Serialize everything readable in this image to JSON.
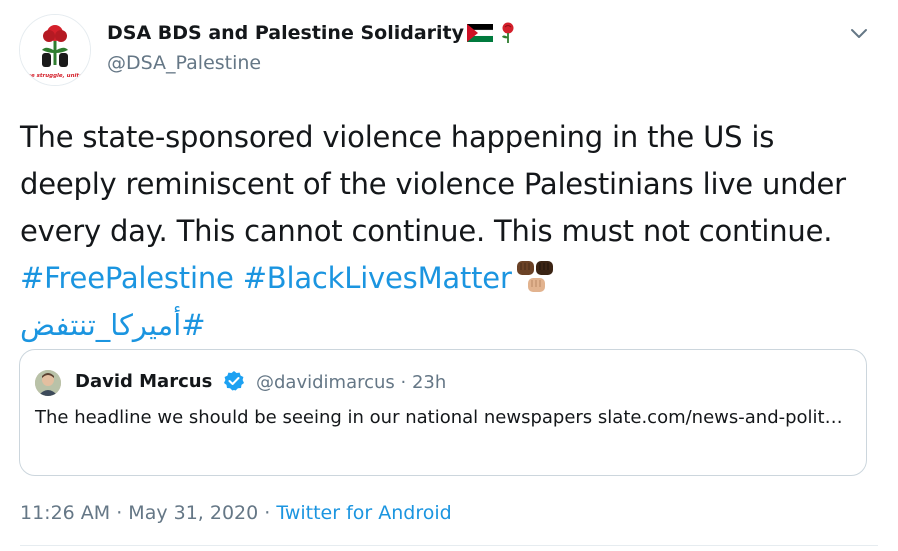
{
  "author": {
    "display_name": "DSA BDS and Palestine Solidarity",
    "handle": "@DSA_Palestine",
    "avatar_caption": "one struggle, united",
    "avatar_icon": "rose-fist-logo",
    "name_emoji": [
      "palestine-flag-icon",
      "rose-icon"
    ]
  },
  "tweet": {
    "text_plain": "The state-sponsored violence happening in the US is deeply reminiscent of the violence Palestinians live under every day. This cannot continue. This must not continue. ",
    "hashtag_1": "#FreePalestine",
    "hashtag_2": "#BlackLivesMatter",
    "hashtag_arabic": "#أميركا_تنتفض",
    "trailing_emoji": "raised-fists-icon"
  },
  "quoted_tweet": {
    "display_name": "David Marcus",
    "handle_time": "@davidimarcus · 23h",
    "text": "The headline we should be seeing in our national newspapers slate.com/news-and-polit…",
    "verified_icon": "verified-badge-icon"
  },
  "meta": {
    "timestamp": "11:26 AM · May 31, 2020 · ",
    "source": "Twitter for Android"
  },
  "colors": {
    "link": "#1b95e0",
    "secondary": "#657786",
    "text": "#14171a",
    "border": "#ccd6dd"
  }
}
